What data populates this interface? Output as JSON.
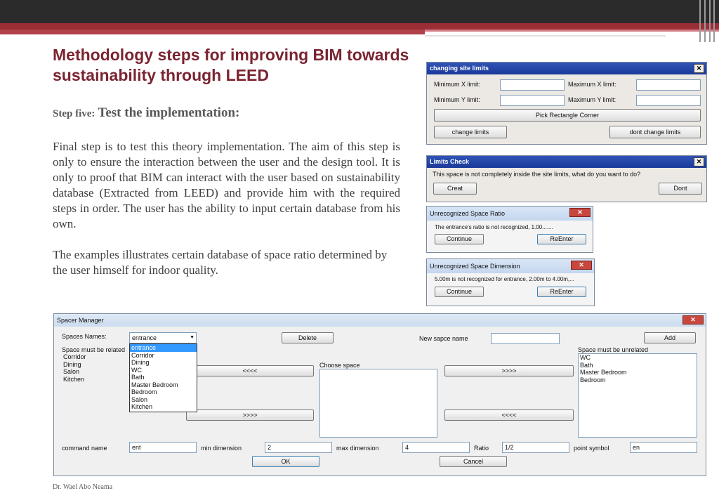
{
  "slide": {
    "title": "Methodology steps for improving BIM towards sustainability through LEED",
    "step_label": "Step five:",
    "step_text": "Test the implementation:",
    "paragraph1": "Final step is to test this theory implementation. The aim of this step is only to ensure the interaction between the user and the design tool. It is only to proof that BIM can interact with the user based on sustainability database (Extracted from LEED) and provide him with the required steps in order. The user has the ability to input certain database from his own.",
    "paragraph2": "The examples illustrates certain database of space ratio determined by the user himself for indoor quality.",
    "footer": "Dr. Wael Abo Neama"
  },
  "site_limits": {
    "title": "changing site limits",
    "min_x_label": "Minimum X limit:",
    "max_x_label": "Maximum X limit:",
    "min_y_label": "Minimum Y limit:",
    "max_y_label": "Maximum Y limit:",
    "pick_button": "Pick Rectangle Corner",
    "change_button": "change limits",
    "dont_change_button": "dont change limits"
  },
  "limits_check": {
    "title": "Limits Check",
    "message": "This space is not completely inside the site limits, what do you want to do?",
    "creat_button": "Creat",
    "dont_button": "Dont"
  },
  "ratio_dialog": {
    "title": "Unrecognized Space Ratio",
    "message": "The entrance's ratio is not recognized, 1.00.......",
    "continue_button": "Continue",
    "reenter_button": "ReEnter"
  },
  "dimension_dialog": {
    "title": "Unrecognized Space Dimension",
    "message": "5.00m is not recognized for entrance, 2.00m to 4.00m,...",
    "continue_button": "Continue",
    "reenter_button": "ReEnter"
  },
  "spacer": {
    "title": "Spacer Manager",
    "spaces_names_label": "Spaces Names:",
    "selected_space": "entrance",
    "delete_button": "Delete",
    "new_name_label": "New sapce name",
    "add_button": "Add",
    "related_label": "Space must be related",
    "related_items": [
      "Corridor",
      "Dining",
      "Salon",
      "Kitchen"
    ],
    "dropdown_items": [
      "entrance",
      "Corridor",
      "Dining",
      "WC",
      "Bath",
      "Master Bedroom",
      "Bedroom",
      "Salon",
      "Kitchen"
    ],
    "move_left_1": "<<<<",
    "move_right_1": ">>>>",
    "move_right_2": ">>>>",
    "move_left_2": "<<<<",
    "choose_label": "Choose space",
    "unrelated_label": "Space must be unrelated",
    "unrelated_items": [
      "WC",
      "Bath",
      "Master Bedroom",
      "Bedroom"
    ],
    "command_label": "command name",
    "command_value": "ent",
    "min_dim_label": "min dimension",
    "min_dim_value": "2",
    "max_dim_label": "max dimension",
    "max_dim_value": "4",
    "ratio_label": "Ratio",
    "ratio_value": "1/2",
    "symbol_label": "point symbol",
    "symbol_value": "en",
    "ok_button": "OK",
    "cancel_button": "Cancel"
  },
  "icons": {
    "close": "close-icon",
    "dropdown": "chevron-down-icon"
  },
  "colors": {
    "title": "#7b2431",
    "accent_bar": "#9b2d35",
    "dialog_title": "#2f54b6"
  }
}
